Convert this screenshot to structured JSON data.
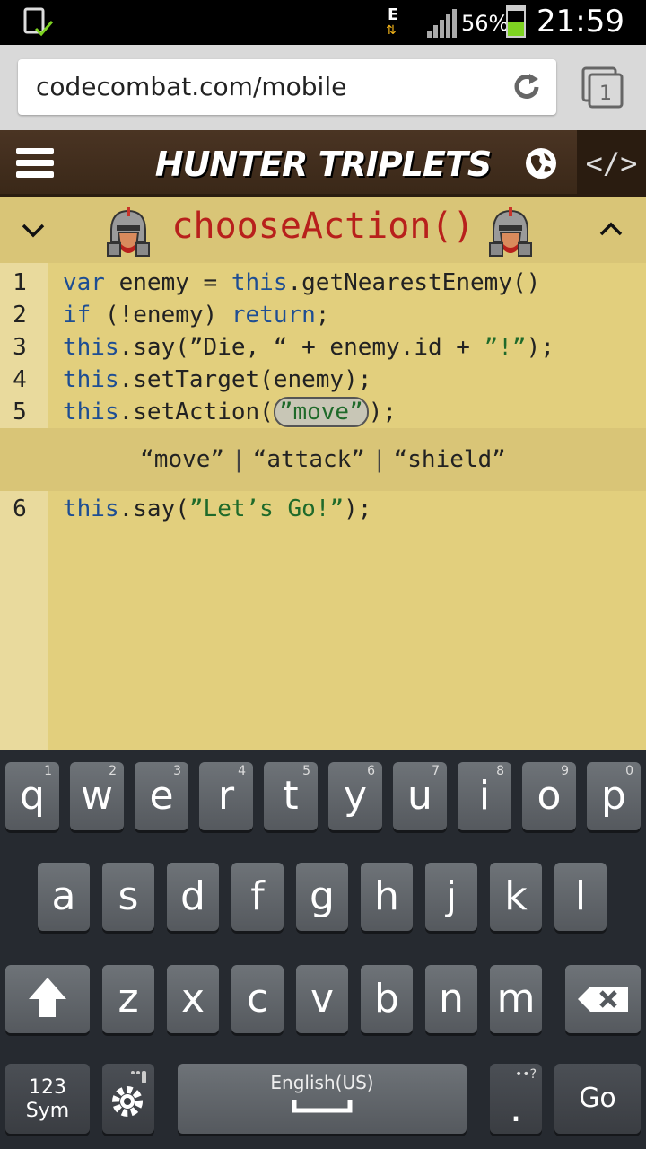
{
  "status_bar": {
    "network_type": "E",
    "battery_percent": "56%",
    "battery_level": 0.56,
    "time": "21:59"
  },
  "browser": {
    "url": "codecombat.com/mobile",
    "tab_count": "1"
  },
  "game_header": {
    "level_title": "HUNTER TRIPLETS",
    "code_toggle_label": "</>"
  },
  "method_bar": {
    "method_name": "chooseAction()"
  },
  "editor": {
    "lines": [
      {
        "number": "1",
        "text": "var enemy = this.getNearestEnemy()"
      },
      {
        "number": "2",
        "text": "if (!enemy) return;"
      },
      {
        "number": "3",
        "text": "this.say(”Die, “ + enemy.id + ”!”);"
      },
      {
        "number": "4",
        "text": "this.setTarget(enemy);"
      },
      {
        "number": "5",
        "text": "this.setAction(”move”);"
      },
      {
        "number": "6",
        "text": "this.say(”Let’s Go!”);"
      }
    ],
    "choices": [
      "“move”",
      "“attack”",
      "“shield”"
    ],
    "choice_separator": "|"
  },
  "keyboard": {
    "row1": [
      {
        "key": "q",
        "sub": "1"
      },
      {
        "key": "w",
        "sub": "2"
      },
      {
        "key": "e",
        "sub": "3"
      },
      {
        "key": "r",
        "sub": "4"
      },
      {
        "key": "t",
        "sub": "5"
      },
      {
        "key": "y",
        "sub": "6"
      },
      {
        "key": "u",
        "sub": "7"
      },
      {
        "key": "i",
        "sub": "8"
      },
      {
        "key": "o",
        "sub": "9"
      },
      {
        "key": "p",
        "sub": "0"
      }
    ],
    "row2": [
      "a",
      "s",
      "d",
      "f",
      "g",
      "h",
      "j",
      "k",
      "l"
    ],
    "row3": [
      "z",
      "x",
      "c",
      "v",
      "b",
      "n",
      "m"
    ],
    "sym_label_1": "123",
    "sym_label_2": "Sym",
    "space_label": "English(US)",
    "period_label": ".",
    "period_sub": "••?",
    "go_label": "Go"
  }
}
